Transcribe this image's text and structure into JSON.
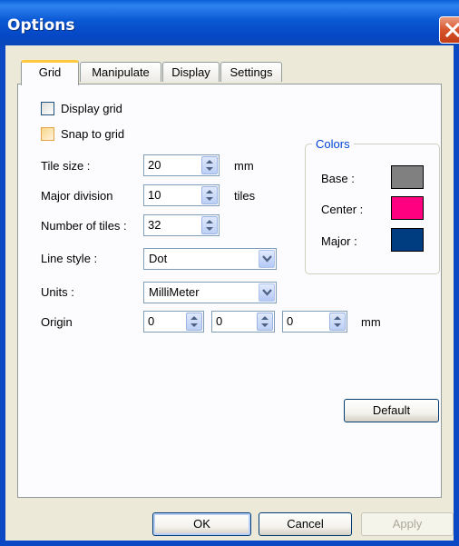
{
  "window": {
    "title": "Options"
  },
  "tabs": [
    "Grid",
    "Manipulate",
    "Display",
    "Settings"
  ],
  "grid": {
    "display_grid": {
      "label": "Display grid",
      "checked": false
    },
    "snap_to_grid": {
      "label": "Snap to grid",
      "checked": false
    },
    "tile_size": {
      "label": "Tile size :",
      "value": "20",
      "unit": "mm"
    },
    "major_division": {
      "label": "Major division",
      "value": "10",
      "unit": "tiles"
    },
    "number_of_tiles": {
      "label": "Number of tiles :",
      "value": "32"
    },
    "line_style": {
      "label": "Line style :",
      "value": "Dot"
    },
    "units": {
      "label": "Units :",
      "value": "MilliMeter"
    },
    "origin": {
      "label": "Origin",
      "x": "0",
      "y": "0",
      "z": "0",
      "unit": "mm"
    },
    "colors": {
      "title": "Colors",
      "base": {
        "label": "Base :",
        "color": "#808080"
      },
      "center": {
        "label": "Center :",
        "color": "#ff0080"
      },
      "major": {
        "label": "Major :",
        "color": "#003c80"
      }
    },
    "default_button": "Default"
  },
  "buttons": {
    "ok": "OK",
    "cancel": "Cancel",
    "apply": "Apply"
  }
}
